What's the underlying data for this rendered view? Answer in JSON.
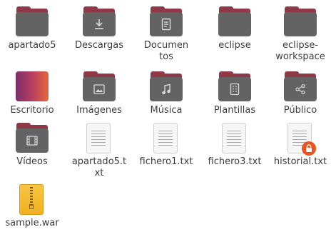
{
  "files": [
    {
      "label": "apartado5",
      "type": "folder",
      "icon": "folder-icon"
    },
    {
      "label": "Descargas",
      "type": "folder",
      "icon": "download-folder-icon"
    },
    {
      "label": "Documentos",
      "type": "folder",
      "icon": "documents-folder-icon"
    },
    {
      "label": "eclipse",
      "type": "folder",
      "icon": "folder-icon"
    },
    {
      "label": "eclipse-workspace",
      "type": "folder",
      "icon": "folder-icon"
    },
    {
      "label": "Escritorio",
      "type": "folder",
      "icon": "desktop-folder-icon"
    },
    {
      "label": "Imágenes",
      "type": "folder",
      "icon": "pictures-folder-icon"
    },
    {
      "label": "Música",
      "type": "folder",
      "icon": "music-folder-icon"
    },
    {
      "label": "Plantillas",
      "type": "folder",
      "icon": "templates-folder-icon"
    },
    {
      "label": "Público",
      "type": "folder",
      "icon": "public-share-folder-icon"
    },
    {
      "label": "Vídeos",
      "type": "folder",
      "icon": "videos-folder-icon"
    },
    {
      "label": "apartado5.txt",
      "type": "text",
      "icon": "text-file-icon"
    },
    {
      "label": "fichero1.txt",
      "type": "text",
      "icon": "text-file-icon"
    },
    {
      "label": "fichero3.txt",
      "type": "text",
      "icon": "text-file-icon"
    },
    {
      "label": "historial.txt",
      "type": "text",
      "icon": "text-file-icon",
      "badge": "lock-icon"
    },
    {
      "label": "sample.war",
      "type": "archive",
      "icon": "archive-file-icon"
    }
  ],
  "colors": {
    "folder_body": "#636363",
    "folder_tab": "#8f3848",
    "lock_badge": "#e95420",
    "archive": "#f2b01f"
  }
}
